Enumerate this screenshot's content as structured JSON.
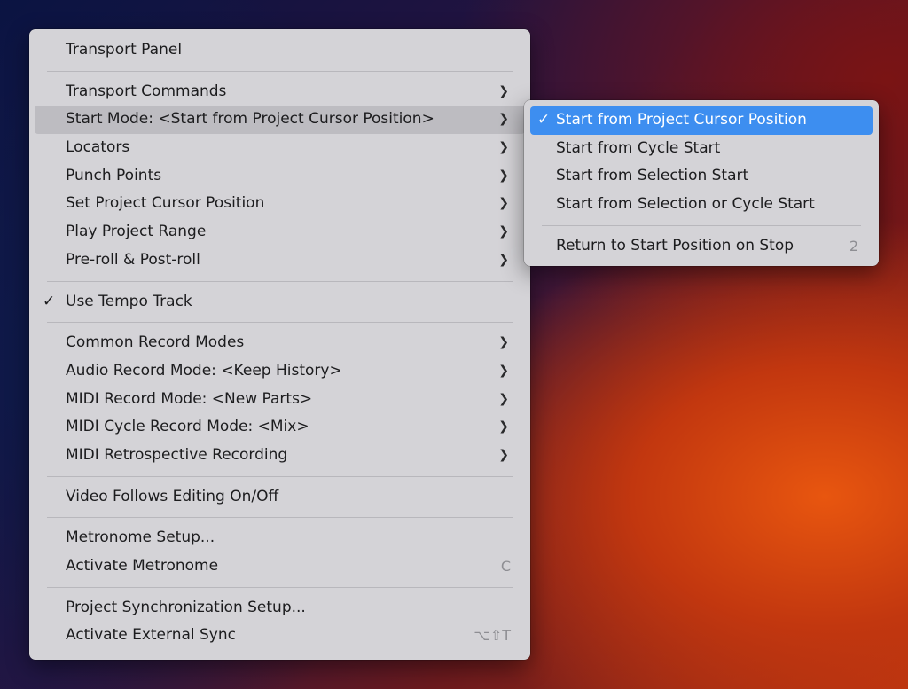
{
  "background": {
    "colors": [
      "#0a1240",
      "#2a1440",
      "#6b1a1e",
      "#e8560f"
    ]
  },
  "main_menu": {
    "items": [
      {
        "label": "Transport Panel"
      },
      {
        "label": "Transport Commands",
        "submenu": true
      },
      {
        "label": "Start Mode: <Start from Project Cursor Position>",
        "submenu": true,
        "active": true
      },
      {
        "label": "Locators",
        "submenu": true
      },
      {
        "label": "Punch Points",
        "submenu": true
      },
      {
        "label": "Set Project Cursor Position",
        "submenu": true
      },
      {
        "label": "Play Project Range",
        "submenu": true
      },
      {
        "label": "Pre-roll & Post-roll",
        "submenu": true
      },
      {
        "label": "Use Tempo Track",
        "checked": true
      },
      {
        "label": "Common Record Modes",
        "submenu": true
      },
      {
        "label": "Audio Record Mode: <Keep History>",
        "submenu": true
      },
      {
        "label": "MIDI Record Mode: <New Parts>",
        "submenu": true
      },
      {
        "label": "MIDI Cycle Record Mode: <Mix>",
        "submenu": true
      },
      {
        "label": "MIDI Retrospective Recording",
        "submenu": true
      },
      {
        "label": "Video Follows Editing On/Off"
      },
      {
        "label": "Metronome Setup..."
      },
      {
        "label": "Activate Metronome",
        "shortcut": "C"
      },
      {
        "label": "Project Synchronization Setup..."
      },
      {
        "label": "Activate External Sync",
        "shortcut": "⌥⇧T"
      }
    ],
    "check_glyph": "✓",
    "chevron_glyph": "❯"
  },
  "sub_menu": {
    "items": [
      {
        "label": "Start from Project Cursor Position",
        "checked": true,
        "selected": true
      },
      {
        "label": "Start from Cycle Start"
      },
      {
        "label": "Start from Selection Start"
      },
      {
        "label": "Start from Selection or Cycle Start"
      },
      {
        "label": "Return to Start Position on Stop",
        "shortcut": "2"
      }
    ],
    "highlight_color": "#3d8ef0"
  }
}
